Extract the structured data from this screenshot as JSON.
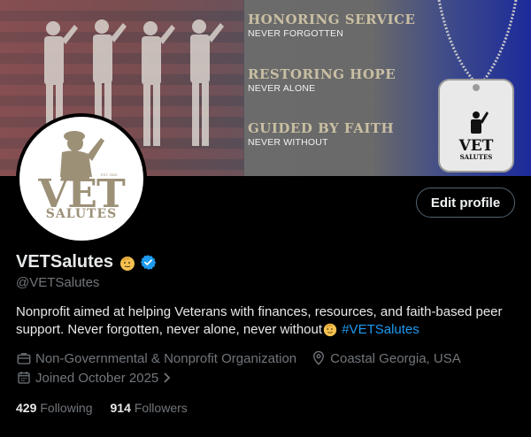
{
  "banner": {
    "slogans": [
      {
        "heading": "HONORING SERVICE",
        "sub": "NEVER FORGOTTEN"
      },
      {
        "heading": "RESTORING HOPE",
        "sub": "NEVER ALONE"
      },
      {
        "heading": "GUIDED BY FAITH",
        "sub": "NEVER WITHOUT"
      }
    ],
    "tag_logo": {
      "vet": "VET",
      "salutes": "SALUTES"
    }
  },
  "avatar": {
    "est": "EST. 2025",
    "vet": "VET",
    "salutes": "SALUTES"
  },
  "profile": {
    "edit_label": "Edit profile",
    "display_name": "VETSalutes",
    "handle": "@VETSalutes",
    "bio_text": "Nonprofit aimed at helping Veterans with finances, resources, and faith-based peer support. Never forgotten, never alone, never without",
    "bio_hashtag": "#VETSalutes",
    "category": "Non-Governmental & Nonprofit Organization",
    "location": "Coastal Georgia, USA",
    "joined": "Joined October 2025",
    "following_count": "429",
    "following_label": "Following",
    "followers_count": "914",
    "followers_label": "Followers"
  },
  "colors": {
    "background": "#000000",
    "accent": "#1d9bf0",
    "muted": "#71767b",
    "text": "#e7e9ea",
    "logo_tan": "#9c9077"
  },
  "icons": [
    "verified-badge-icon",
    "saluting-face-emoji-icon",
    "briefcase-icon",
    "location-pin-icon",
    "calendar-icon",
    "chevron-right-icon"
  ]
}
